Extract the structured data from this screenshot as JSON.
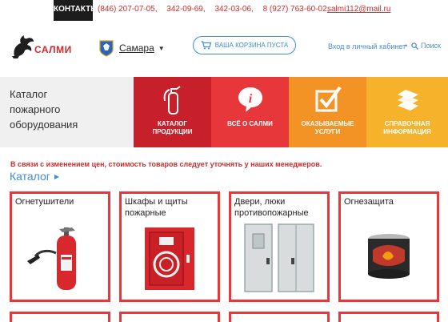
{
  "topbar": {
    "contacts_label": "КОНТАКТЫ:",
    "phones": [
      "(846) 207-07-05,",
      "342-09-69,",
      "342-03-06,",
      "8 (927) 763-60-02,"
    ],
    "email": "salmi112@mail.ru"
  },
  "header": {
    "logo_text": "САЛМИ",
    "city": "Самара",
    "cart_label": "ВАША КОРЗИНА ПУСТА",
    "login_label": "Вход в личный кабинет",
    "separator": "•",
    "search_label": "Поиск"
  },
  "banner": {
    "title_lines": [
      "Каталог",
      "пожарного",
      "оборудования"
    ],
    "tiles": [
      {
        "label": "КАТАЛОГ ПРОДУКЦИИ",
        "icon": "fire-extinguisher-icon",
        "color": "#c8202a"
      },
      {
        "label": "ВСЁ О САЛМИ",
        "icon": "info-bubble-icon",
        "color": "#e8373b"
      },
      {
        "label": "ОКАЗЫВАЕМЫЕ УСЛУГИ",
        "icon": "checkbox-icon",
        "color": "#f39325"
      },
      {
        "label": "СПРАВОЧНАЯ ИНФОРМАЦИЯ",
        "icon": "books-icon",
        "color": "#f6b22b"
      }
    ]
  },
  "notice": "В связи с изменением цен, стоимость товаров следует уточнять у наших менеджеров.",
  "catalog": {
    "heading": "Каталог",
    "cards": [
      {
        "title_lines": [
          "Огнетушители"
        ],
        "icon": "extinguisher-image"
      },
      {
        "title_lines": [
          "Шкафы и щиты",
          "пожарные"
        ],
        "icon": "fire-cabinet-image"
      },
      {
        "title_lines": [
          "Двери, люки",
          "противопожарные"
        ],
        "icon": "fire-door-image"
      },
      {
        "title_lines": [
          "Огнезащита"
        ],
        "icon": "fire-protection-can-image"
      }
    ]
  },
  "colors": {
    "accent_red": "#e8373b",
    "link_blue": "#3c8ed6"
  }
}
